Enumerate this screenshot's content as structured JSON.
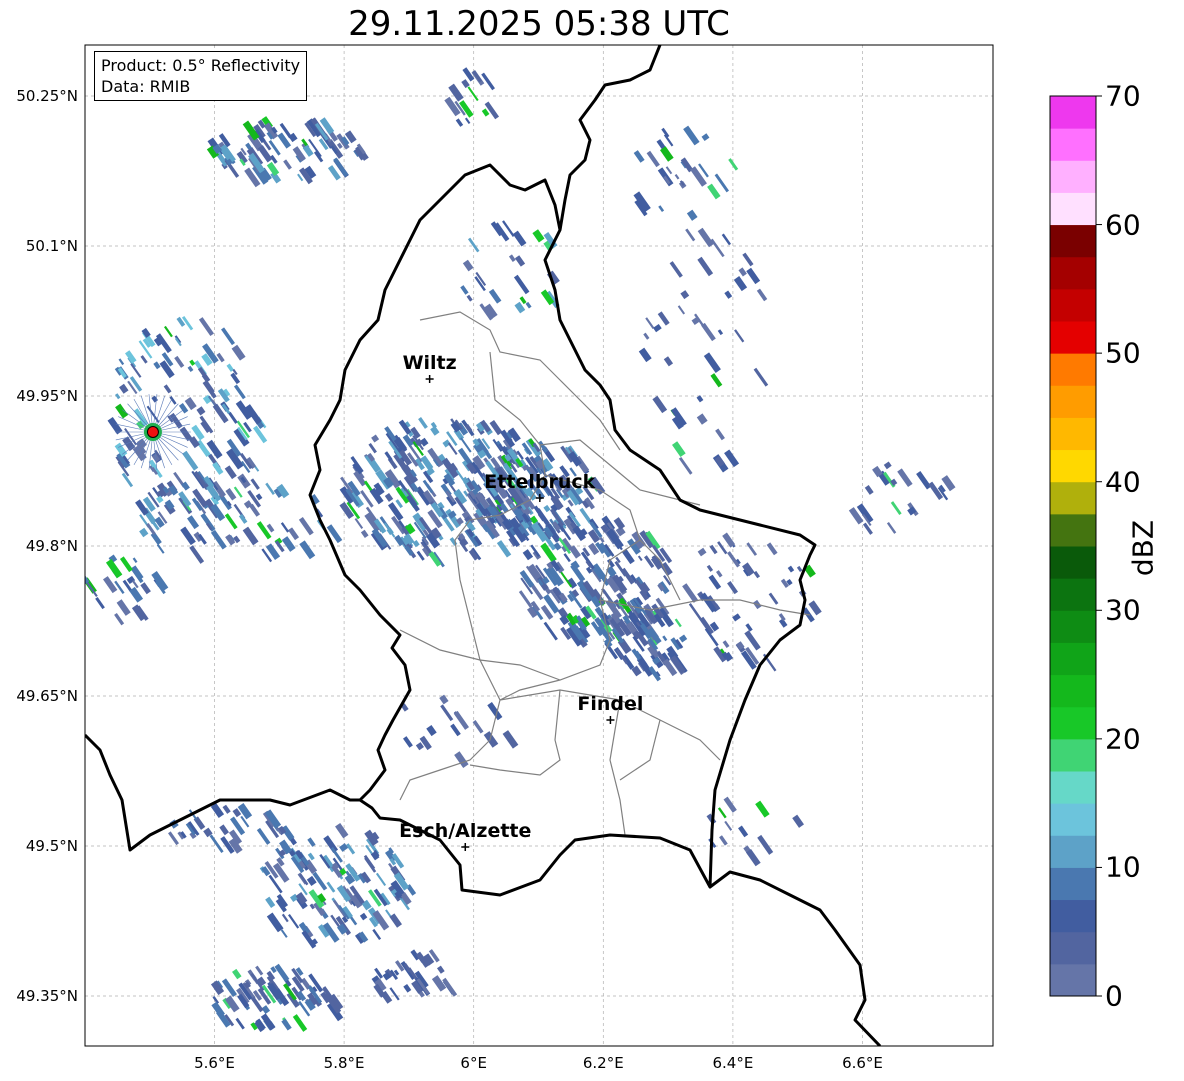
{
  "title": "29.11.2025 05:38 UTC",
  "product_box": {
    "product": "Product: 0.5° Reflectivity",
    "data": "Data: RMIB"
  },
  "axes": {
    "lat_ticks": [
      "50.25°N",
      "50.1°N",
      "49.95°N",
      "49.8°N",
      "49.65°N",
      "49.5°N",
      "49.35°N"
    ],
    "lon_ticks": [
      "5.6°E",
      "5.8°E",
      "6°E",
      "6.2°E",
      "6.4°E",
      "6.6°E"
    ],
    "lat_range": [
      49.3,
      50.3
    ],
    "lon_range": [
      5.4,
      6.8
    ],
    "grid": true
  },
  "cities": [
    {
      "name": "Wiltz",
      "lat": 49.967,
      "lon": 5.932
    },
    {
      "name": "Ettelbruck",
      "lat": 49.848,
      "lon": 6.102
    },
    {
      "name": "Findel",
      "lat": 49.626,
      "lon": 6.211
    },
    {
      "name": "Esch/Alzette",
      "lat": 49.499,
      "lon": 5.987
    }
  ],
  "radar_site": {
    "lat": 49.914,
    "lon": 5.505
  },
  "colorbar": {
    "label": "dBZ",
    "ticks": [
      "0",
      "10",
      "20",
      "30",
      "40",
      "50",
      "60",
      "70"
    ],
    "min": 0,
    "max": 70,
    "step": 2.5,
    "colors": [
      "#6575a8",
      "#5265a0",
      "#415da0",
      "#4a78b0",
      "#5da2c8",
      "#6cc4dc",
      "#66d8c8",
      "#40d474",
      "#18c828",
      "#14b81c",
      "#10a418",
      "#0e8c14",
      "#0c7410",
      "#0a5a0a",
      "#447410",
      "#b0b00c",
      "#ffd800",
      "#ffb800",
      "#ff9c00",
      "#ff7a00",
      "#e40000",
      "#c40000",
      "#a40000",
      "#7a0000",
      "#ffe0ff",
      "#ffb0ff",
      "#ff70ff",
      "#ee38ee"
    ]
  },
  "echo_regions": [
    {
      "lat": 49.86,
      "lon": 5.95,
      "dlat": 0.07,
      "dlon": 0.17,
      "n": 260,
      "lev": 5
    },
    {
      "lat": 49.86,
      "lon": 6.08,
      "dlat": 0.05,
      "dlon": 0.1,
      "n": 140,
      "lev": 5
    },
    {
      "lat": 49.77,
      "lon": 6.18,
      "dlat": 0.06,
      "dlon": 0.12,
      "n": 160,
      "lev": 4
    },
    {
      "lat": 49.71,
      "lon": 6.26,
      "dlat": 0.04,
      "dlon": 0.06,
      "n": 60,
      "lev": 4
    },
    {
      "lat": 49.46,
      "lon": 5.78,
      "dlat": 0.06,
      "dlon": 0.12,
      "n": 120,
      "lev": 5
    },
    {
      "lat": 49.35,
      "lon": 5.68,
      "dlat": 0.03,
      "dlon": 0.1,
      "n": 70,
      "lev": 4
    },
    {
      "lat": 49.37,
      "lon": 5.9,
      "dlat": 0.03,
      "dlon": 0.06,
      "n": 30,
      "lev": 3
    },
    {
      "lat": 50.2,
      "lon": 5.7,
      "dlat": 0.03,
      "dlon": 0.12,
      "n": 80,
      "lev": 5
    },
    {
      "lat": 49.93,
      "lon": 5.55,
      "dlat": 0.1,
      "dlon": 0.12,
      "n": 130,
      "lev": 6
    },
    {
      "lat": 49.83,
      "lon": 5.62,
      "dlat": 0.04,
      "dlon": 0.16,
      "n": 70,
      "lev": 5
    },
    {
      "lat": 49.76,
      "lon": 5.45,
      "dlat": 0.03,
      "dlon": 0.06,
      "n": 25,
      "lev": 4
    },
    {
      "lat": 49.75,
      "lon": 6.42,
      "dlat": 0.07,
      "dlon": 0.1,
      "n": 50,
      "lev": 3
    },
    {
      "lat": 49.85,
      "lon": 6.65,
      "dlat": 0.04,
      "dlon": 0.08,
      "n": 20,
      "lev": 3
    },
    {
      "lat": 50.08,
      "lon": 6.05,
      "dlat": 0.05,
      "dlon": 0.08,
      "n": 25,
      "lev": 5
    },
    {
      "lat": 50.0,
      "lon": 6.35,
      "dlat": 0.12,
      "dlon": 0.1,
      "n": 40,
      "lev": 3
    },
    {
      "lat": 49.52,
      "lon": 5.62,
      "dlat": 0.02,
      "dlon": 0.1,
      "n": 30,
      "lev": 4
    },
    {
      "lat": 50.25,
      "lon": 5.98,
      "dlat": 0.03,
      "dlon": 0.05,
      "n": 15,
      "lev": 3
    },
    {
      "lat": 49.62,
      "lon": 5.95,
      "dlat": 0.03,
      "dlon": 0.1,
      "n": 15,
      "lev": 3
    },
    {
      "lat": 49.52,
      "lon": 6.42,
      "dlat": 0.03,
      "dlon": 0.08,
      "n": 12,
      "lev": 3
    },
    {
      "lat": 50.18,
      "lon": 6.3,
      "dlat": 0.05,
      "dlon": 0.1,
      "n": 25,
      "lev": 4
    }
  ]
}
